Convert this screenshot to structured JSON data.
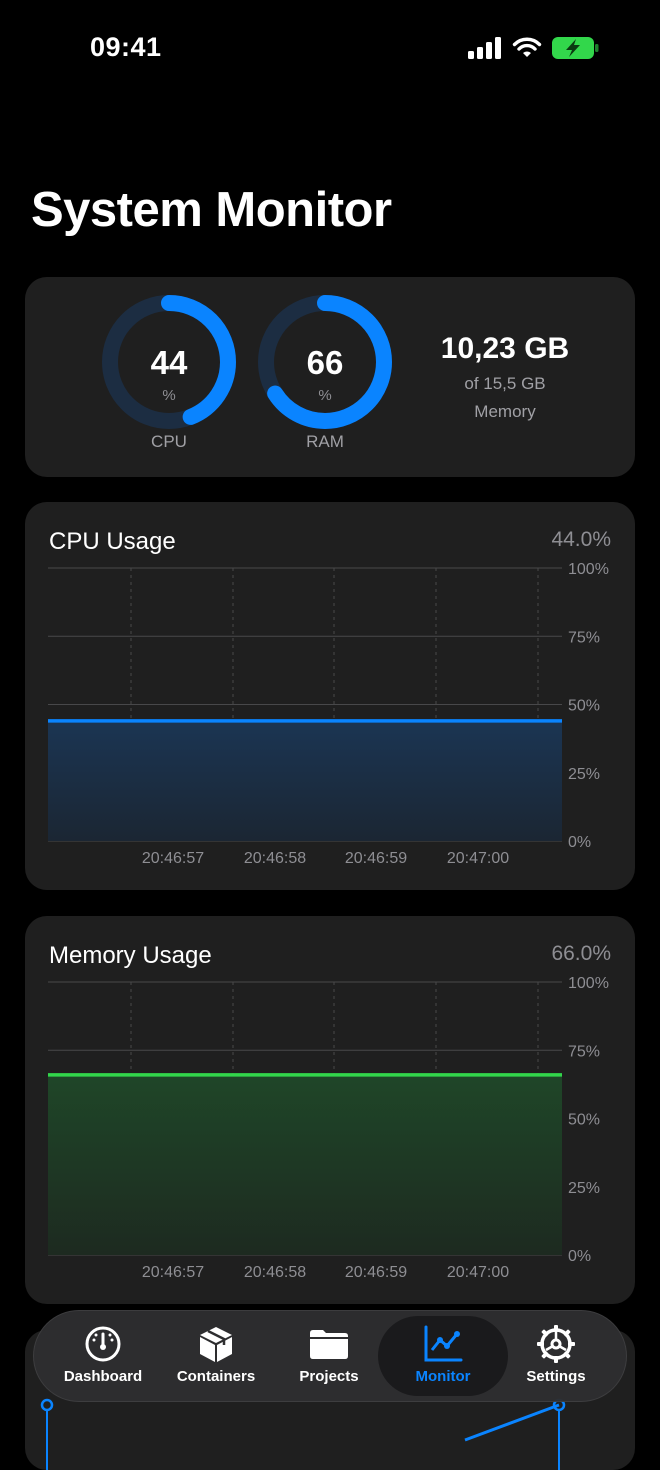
{
  "status_bar": {
    "time": "09:41"
  },
  "header": {
    "title": "System Monitor"
  },
  "summary": {
    "cpu": {
      "value": "44",
      "unit": "%",
      "label": "CPU",
      "fraction": 0.44
    },
    "ram": {
      "value": "66",
      "unit": "%",
      "label": "RAM",
      "fraction": 0.66
    },
    "memory": {
      "used": "10,23 GB",
      "total": "of 15,5 GB",
      "label": "Memory"
    }
  },
  "cpu_chart": {
    "title": "CPU Usage",
    "current": "44.0%"
  },
  "memory_chart": {
    "title": "Memory Usage",
    "current": "66.0%"
  },
  "colors": {
    "accent": "#0a84ff",
    "cpu_line": "#0a84ff",
    "memory_line": "#32d74b",
    "card": "#1f1f1f"
  },
  "chart_data": [
    {
      "type": "area",
      "title": "CPU Usage",
      "x": [
        "20:46:57",
        "20:46:58",
        "20:46:59",
        "20:47:00"
      ],
      "series": [
        {
          "values": [
            44,
            44,
            44,
            44
          ]
        }
      ],
      "y_ticks": [
        "100%",
        "75%",
        "50%",
        "25%",
        "0%"
      ],
      "ylim": [
        0,
        100
      ],
      "grid": true
    },
    {
      "type": "area",
      "title": "Memory Usage",
      "x": [
        "20:46:57",
        "20:46:58",
        "20:46:59",
        "20:47:00"
      ],
      "series": [
        {
          "values": [
            66,
            66,
            66,
            66
          ]
        }
      ],
      "y_ticks": [
        "100%",
        "75%",
        "50%",
        "25%",
        "0%"
      ],
      "ylim": [
        0,
        100
      ],
      "grid": true
    }
  ],
  "tabs": [
    {
      "label": "Dashboard",
      "icon": "gauge-icon"
    },
    {
      "label": "Containers",
      "icon": "cube-icon"
    },
    {
      "label": "Projects",
      "icon": "folder-icon"
    },
    {
      "label": "Monitor",
      "icon": "chart-line-icon",
      "active": true
    },
    {
      "label": "Settings",
      "icon": "gear-icon"
    }
  ]
}
